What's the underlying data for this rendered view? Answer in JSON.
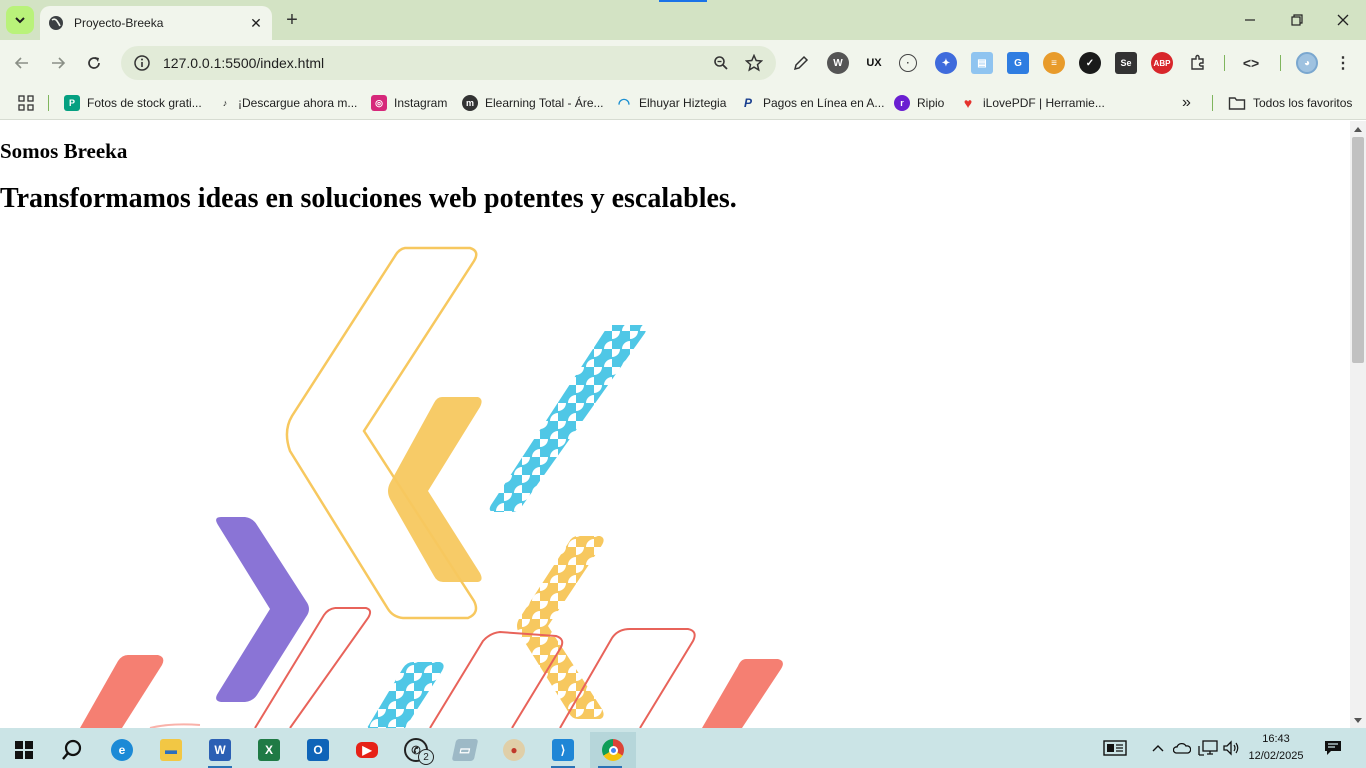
{
  "browser": {
    "tab_title": "Proyecto-Breeka",
    "url": "127.0.0.1:5500/index.html",
    "new_tab_symbol": "+",
    "close_tab_symbol": "✕"
  },
  "bookmarks": [
    {
      "label": "Fotos de stock grati...",
      "icon": "pexels-icon",
      "color": "#05a081",
      "glyph": "P"
    },
    {
      "label": "¡Descargue ahora m...",
      "icon": "tiktok-icon",
      "color": "#111111",
      "glyph": "♪"
    },
    {
      "label": "Instagram",
      "icon": "instagram-icon",
      "color": "#d6287a",
      "glyph": "◎"
    },
    {
      "label": "Elearning Total - Áre...",
      "icon": "moodle-icon",
      "color": "#333333",
      "glyph": "m"
    },
    {
      "label": "Elhuyar Hiztegia",
      "icon": "elhuyar-icon",
      "color": "#1b8fd1",
      "glyph": "◠"
    },
    {
      "label": "Pagos en Línea en A...",
      "icon": "paypal-icon",
      "color": "#1a3f8f",
      "glyph": "P"
    },
    {
      "label": "Ripio",
      "icon": "ripio-icon",
      "color": "#6a1fd1",
      "glyph": "r"
    },
    {
      "label": "iLovePDF | Herramie...",
      "icon": "ilovepdf-icon",
      "color": "#e5322d",
      "glyph": "♥"
    }
  ],
  "bookmarks_more": "»",
  "all_bookmarks": "Todos los favoritos",
  "page": {
    "subtitle": "Somos Breeka",
    "headline": "Transformamos ideas en soluciones web potentes y escalables."
  },
  "taskbar": {
    "time": "16:43",
    "date": "12/02/2025",
    "whatsapp_badge": "2"
  },
  "colors": {
    "accent_yellow": "#f7c85f",
    "accent_blue": "#4fc7e6",
    "accent_purple": "#8a74d6",
    "accent_red": "#f57f72",
    "chrome_green": "#d3e3c4"
  }
}
